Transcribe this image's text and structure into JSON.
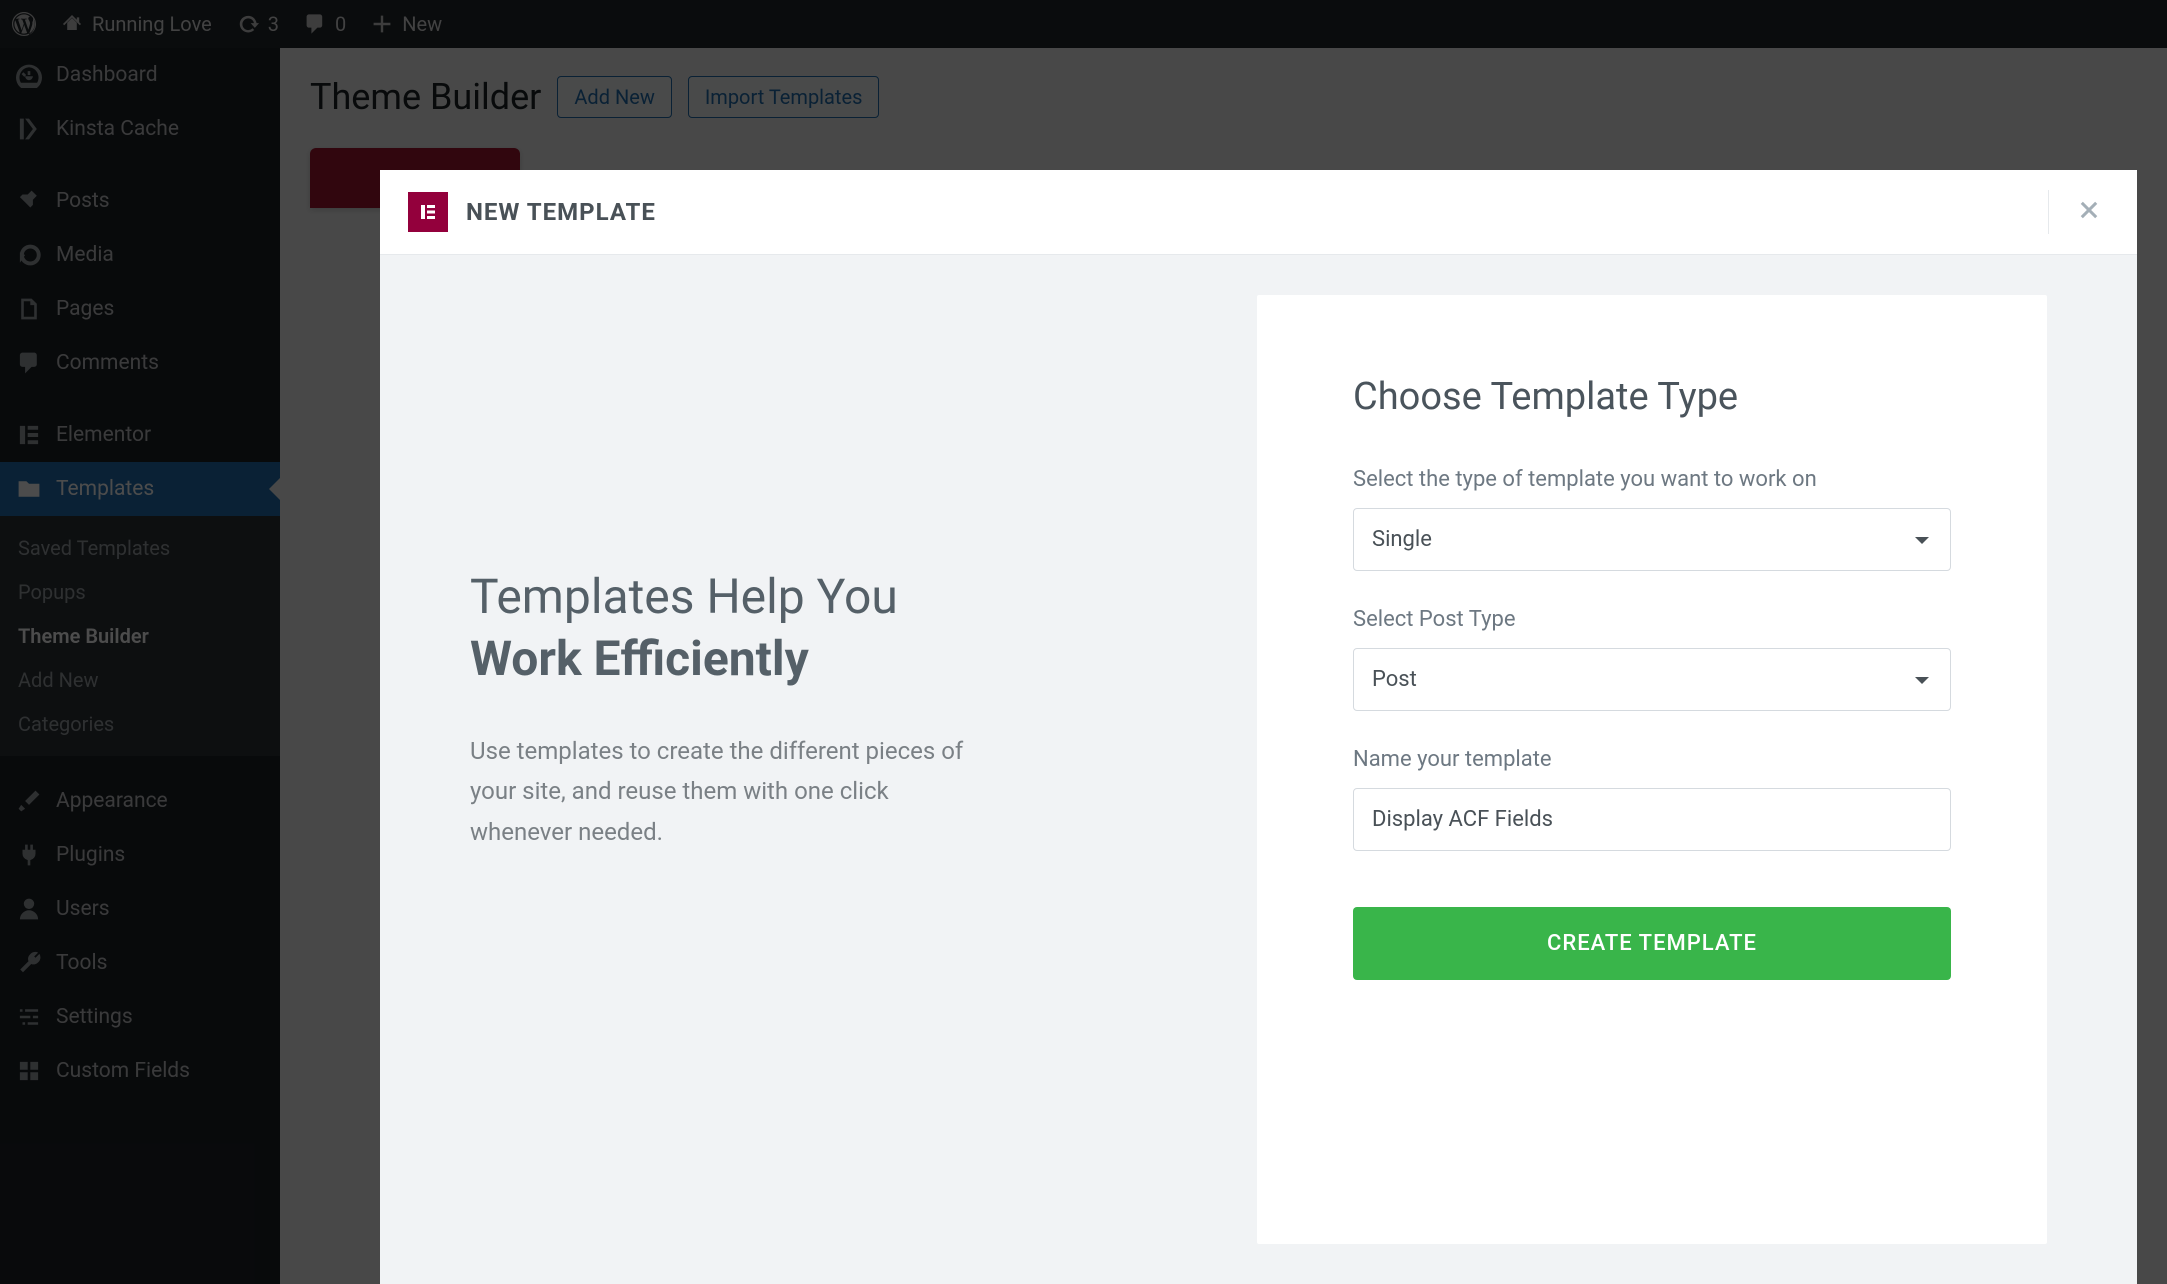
{
  "adminBar": {
    "siteName": "Running Love",
    "updatesCount": "3",
    "commentsCount": "0",
    "newLabel": "New"
  },
  "sidebar": {
    "dashboard": "Dashboard",
    "kinsta": "Kinsta Cache",
    "posts": "Posts",
    "media": "Media",
    "pages": "Pages",
    "comments": "Comments",
    "elementor": "Elementor",
    "templates": "Templates",
    "sub": {
      "saved": "Saved Templates",
      "popups": "Popups",
      "themeBuilder": "Theme Builder",
      "addNew": "Add New",
      "categories": "Categories"
    },
    "appearance": "Appearance",
    "plugins": "Plugins",
    "users": "Users",
    "tools": "Tools",
    "settings": "Settings",
    "customFields": "Custom Fields"
  },
  "page": {
    "title": "Theme Builder",
    "addNew": "Add New",
    "import": "Import Templates"
  },
  "modal": {
    "title": "NEW TEMPLATE",
    "leftTitleLine1": "Templates Help You",
    "leftTitleLine2": "Work Efficiently",
    "leftBody": "Use templates to create the different pieces of your site, and reuse them with one click whenever needed.",
    "formTitle": "Choose Template Type",
    "typeLabel": "Select the type of template you want to work on",
    "typeValue": "Single",
    "postTypeLabel": "Select Post Type",
    "postTypeValue": "Post",
    "nameLabel": "Name your template",
    "nameValue": "Display ACF Fields",
    "createBtn": "CREATE TEMPLATE"
  }
}
